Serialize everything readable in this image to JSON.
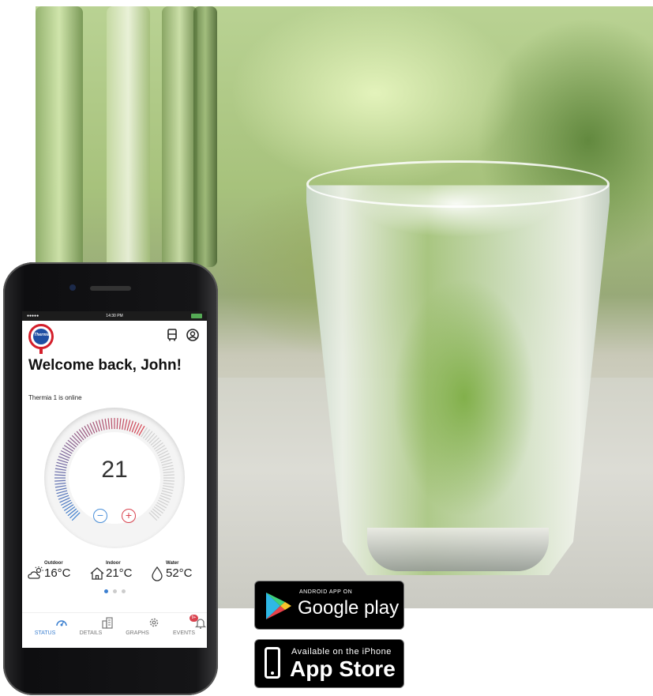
{
  "photo": {
    "subject_icon": "glass-of-water-icon"
  },
  "phone": {
    "status_bar": {
      "carrier": "●●●●●",
      "time": "14:30 PM"
    },
    "brand_logo_text": "Thermia",
    "header_icons": [
      "device-icon",
      "profile-icon"
    ],
    "welcome": "Welcome back, John!",
    "online_status": "Thermia 1 is online",
    "dial": {
      "value": "21",
      "level_fraction": 0.62,
      "minus": "−",
      "plus": "+"
    },
    "metrics": [
      {
        "label": "Outdoor",
        "value": "16°C",
        "icon": "sun-cloud-icon"
      },
      {
        "label": "Indoor",
        "value": "21°C",
        "icon": "house-icon"
      },
      {
        "label": "Water",
        "value": "52°C",
        "icon": "water-drop-icon"
      }
    ],
    "pager": {
      "count": 3,
      "active": 0
    },
    "tabs": [
      {
        "label": "STATUS",
        "icon": "gauge-icon",
        "active": true
      },
      {
        "label": "DETAILS",
        "icon": "building-icon",
        "active": false
      },
      {
        "label": "GRAPHS",
        "icon": "gear-icon",
        "active": false
      },
      {
        "label": "EVENTS",
        "icon": "bell-icon",
        "active": false,
        "badge": "9+"
      }
    ]
  },
  "stores": {
    "google": {
      "small": "ANDROID APP ON",
      "big": "Google play"
    },
    "apple": {
      "small": "Available on the iPhone",
      "big": "App Store"
    }
  },
  "colors": {
    "accent_blue": "#3b7fd0",
    "accent_red": "#d9434f",
    "logo_red": "#d41f2b",
    "logo_blue": "#1f4fa3"
  }
}
